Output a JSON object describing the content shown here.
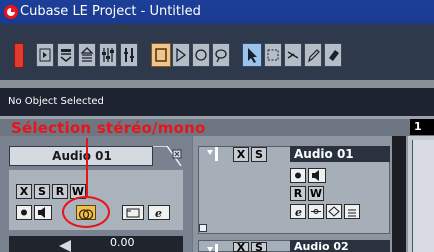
{
  "window": {
    "title": "Cubase LE Project - Untitled"
  },
  "status": {
    "text": "No Object Selected"
  },
  "annotation": {
    "text": "Sélection stéréo/mono"
  },
  "inspector": {
    "track_name": "Audio 01",
    "volume_value": "0.00",
    "buttons_row1": [
      "X",
      "S",
      "R",
      "W"
    ],
    "buttons_row2_icons": [
      "record-enable-icon",
      "monitor-icon",
      "stereo-mono-icon",
      "folder-icon",
      "edit-icon"
    ]
  },
  "tracks": [
    {
      "name": "Audio 01",
      "buttons": [
        "X",
        "S",
        "R",
        "W"
      ]
    },
    {
      "name": "Audio 02",
      "buttons": [
        "X",
        "S"
      ]
    }
  ],
  "ruler": {
    "mark": "1"
  },
  "colors": {
    "annotation": "#e8141a",
    "titlebar": "#1c3f9a",
    "stereo_button": "#f0c050"
  }
}
